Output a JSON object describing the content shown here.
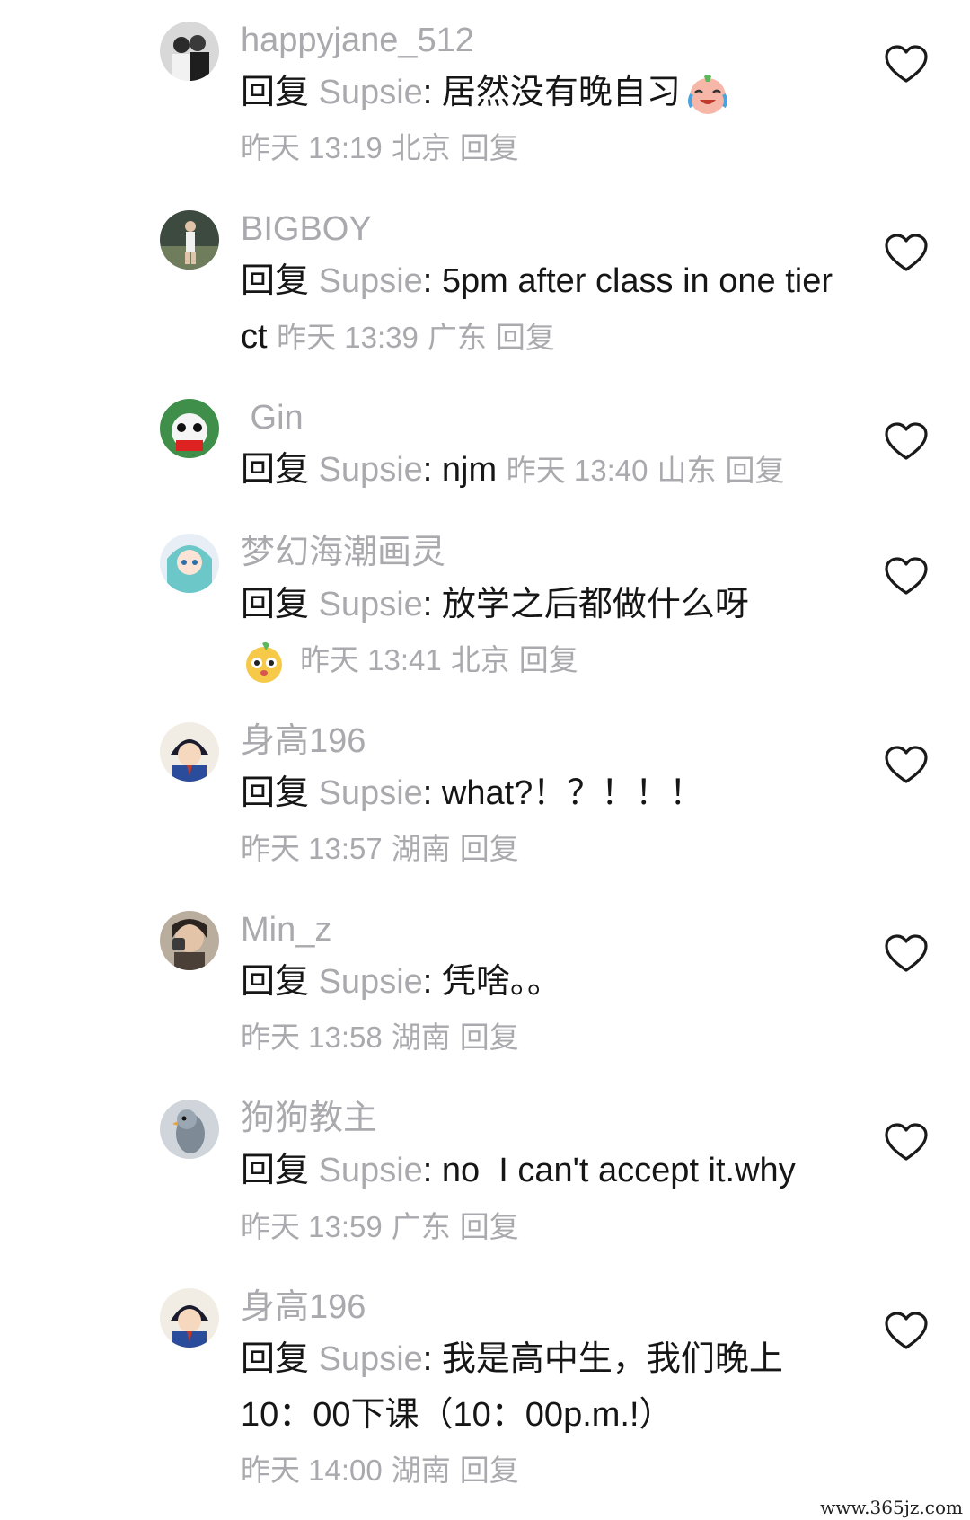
{
  "comments": [
    {
      "username": "happyjane_512",
      "reply_word": "回复",
      "reply_target": "Supsie",
      "text": "居然没有晚自习",
      "emoji": "laughing-crying-emoji",
      "time": "昨天 13:19",
      "location": "北京",
      "reply_label": "回复"
    },
    {
      "username": "BIGBOY",
      "reply_word": "回复",
      "reply_target": "Supsie",
      "text": "5pm after class in one tier ct",
      "time": "昨天 13:39",
      "location": "广东",
      "reply_label": "回复"
    },
    {
      "username": " Gin",
      "reply_word": "回复",
      "reply_target": "Supsie",
      "text": "njm",
      "time": "昨天 13:40",
      "location": "山东",
      "reply_label": "回复"
    },
    {
      "username": "梦幻海潮画灵",
      "reply_word": "回复",
      "reply_target": "Supsie",
      "text": "放学之后都做什么呀",
      "emoji": "curious-face-emoji",
      "time": "昨天 13:41",
      "location": "北京",
      "reply_label": "回复"
    },
    {
      "username": "身高196",
      "reply_word": "回复",
      "reply_target": "Supsie",
      "text": "what?！？！！！",
      "time": "昨天 13:57",
      "location": "湖南",
      "reply_label": "回复"
    },
    {
      "username": "Min_z",
      "reply_word": "回复",
      "reply_target": "Supsie",
      "text": "凭啥。。",
      "time": "昨天 13:58",
      "location": "湖南",
      "reply_label": "回复"
    },
    {
      "username": "狗狗教主",
      "reply_word": "回复",
      "reply_target": "Supsie",
      "text": "no  I can't accept it.why",
      "time": "昨天 13:59",
      "location": "广东",
      "reply_label": "回复"
    },
    {
      "username": "身高196",
      "reply_word": "回复",
      "reply_target": "Supsie",
      "text": "我是高中生，我们晚上10：00下课（10：00p.m.!）",
      "time": "昨天 14:00",
      "location": "湖南",
      "reply_label": "回复"
    }
  ],
  "icons": {
    "like": "heart-outline-icon",
    "avatar": "user-avatar"
  },
  "colors": {
    "text": "#161616",
    "muted": "#a9a9ae",
    "background": "#ffffff"
  },
  "watermark": "www.365jz.com"
}
